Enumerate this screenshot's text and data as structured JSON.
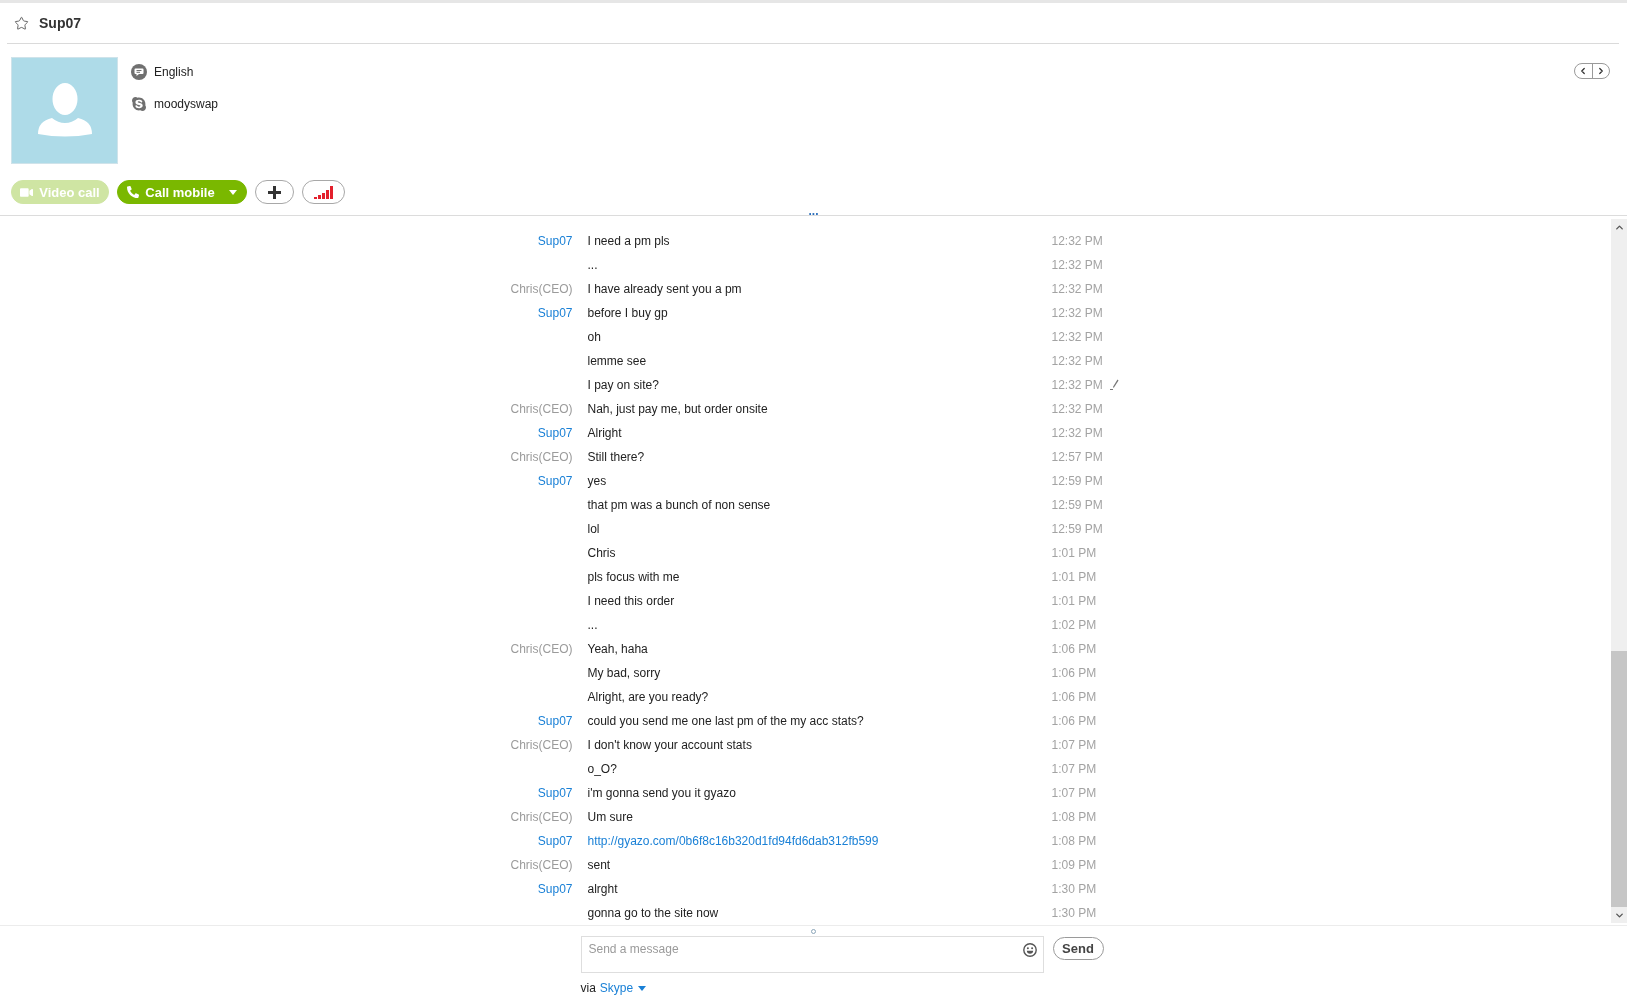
{
  "header": {
    "title": "Sup07",
    "favorite": false
  },
  "profile": {
    "language": "English",
    "account_name": "moodyswap"
  },
  "actions": [
    {
      "kind": "video",
      "label": "Video call",
      "disabled": true,
      "dropdown": false
    },
    {
      "kind": "call",
      "label": "Call mobile",
      "disabled": false,
      "dropdown": true
    },
    {
      "kind": "add",
      "disabled": false,
      "dropdown": false
    },
    {
      "kind": "call_quality",
      "disabled": false,
      "dropdown": false
    }
  ],
  "chat": {
    "load_more": "...",
    "messages": [
      {
        "sender": {
          "name": "Sup07",
          "kind": "self"
        },
        "text": "I need a pm pls",
        "time": "12:32 PM",
        "link": false,
        "edited": false
      },
      {
        "text": "...",
        "time": "12:32 PM",
        "link": false,
        "edited": false
      },
      {
        "sender": {
          "name": "Chris(CEO)",
          "kind": "contact"
        },
        "text": "I have already sent you a pm",
        "time": "12:32 PM",
        "link": false,
        "edited": false
      },
      {
        "sender": {
          "name": "Sup07",
          "kind": "self"
        },
        "text": "before I buy gp",
        "time": "12:32 PM",
        "link": false,
        "edited": false
      },
      {
        "text": "oh",
        "time": "12:32 PM",
        "link": false,
        "edited": false
      },
      {
        "text": "lemme see",
        "time": "12:32 PM",
        "link": false,
        "edited": false
      },
      {
        "text": "I pay on site?",
        "time": "12:32 PM",
        "link": false,
        "edited": true
      },
      {
        "sender": {
          "name": "Chris(CEO)",
          "kind": "contact"
        },
        "text": "Nah, just pay me, but order onsite",
        "time": "12:32 PM",
        "link": false,
        "edited": false
      },
      {
        "sender": {
          "name": "Sup07",
          "kind": "self"
        },
        "text": "Alright",
        "time": "12:32 PM",
        "link": false,
        "edited": false
      },
      {
        "sender": {
          "name": "Chris(CEO)",
          "kind": "contact"
        },
        "text": "Still there?",
        "time": "12:57 PM",
        "link": false,
        "edited": false
      },
      {
        "sender": {
          "name": "Sup07",
          "kind": "self"
        },
        "text": "yes",
        "time": "12:59 PM",
        "link": false,
        "edited": false
      },
      {
        "text": "that pm was a bunch of non sense",
        "time": "12:59 PM",
        "link": false,
        "edited": false
      },
      {
        "text": "lol",
        "time": "12:59 PM",
        "link": false,
        "edited": false
      },
      {
        "text": "Chris",
        "time": "1:01 PM",
        "link": false,
        "edited": false
      },
      {
        "text": "pls focus with me",
        "time": "1:01 PM",
        "link": false,
        "edited": false
      },
      {
        "text": "I need this order",
        "time": "1:01 PM",
        "link": false,
        "edited": false
      },
      {
        "text": "...",
        "time": "1:02 PM",
        "link": false,
        "edited": false
      },
      {
        "sender": {
          "name": "Chris(CEO)",
          "kind": "contact"
        },
        "text": "Yeah, haha",
        "time": "1:06 PM",
        "link": false,
        "edited": false
      },
      {
        "text": "My bad, sorry",
        "time": "1:06 PM",
        "link": false,
        "edited": false
      },
      {
        "text": "Alright, are you ready?",
        "time": "1:06 PM",
        "link": false,
        "edited": false
      },
      {
        "sender": {
          "name": "Sup07",
          "kind": "self"
        },
        "text": "could you send me one last pm of the my acc stats?",
        "time": "1:06 PM",
        "link": false,
        "edited": false
      },
      {
        "sender": {
          "name": "Chris(CEO)",
          "kind": "contact"
        },
        "text": "I don't know your account stats",
        "time": "1:07 PM",
        "link": false,
        "edited": false
      },
      {
        "text": "o_O?",
        "time": "1:07 PM",
        "link": false,
        "edited": false
      },
      {
        "sender": {
          "name": "Sup07",
          "kind": "self"
        },
        "text": "i'm gonna send you it gyazo",
        "time": "1:07 PM",
        "link": false,
        "edited": false
      },
      {
        "sender": {
          "name": "Chris(CEO)",
          "kind": "contact"
        },
        "text": "Um sure",
        "time": "1:08 PM",
        "link": false,
        "edited": false
      },
      {
        "sender": {
          "name": "Sup07",
          "kind": "self"
        },
        "text": "http://gyazo.com/0b6f8c16b320d1fd94fd6dab312fb599",
        "time": "1:08 PM",
        "link": true,
        "edited": false
      },
      {
        "sender": {
          "name": "Chris(CEO)",
          "kind": "contact"
        },
        "text": "sent",
        "time": "1:09 PM",
        "link": false,
        "edited": false
      },
      {
        "sender": {
          "name": "Sup07",
          "kind": "self"
        },
        "text": "alrght",
        "time": "1:30 PM",
        "link": false,
        "edited": false
      },
      {
        "text": "gonna go to the site now",
        "time": "1:30 PM",
        "link": false,
        "edited": false
      }
    ]
  },
  "compose": {
    "placeholder": "Send a message",
    "send_label": "Send",
    "via_label": "via",
    "service": "Skype"
  }
}
